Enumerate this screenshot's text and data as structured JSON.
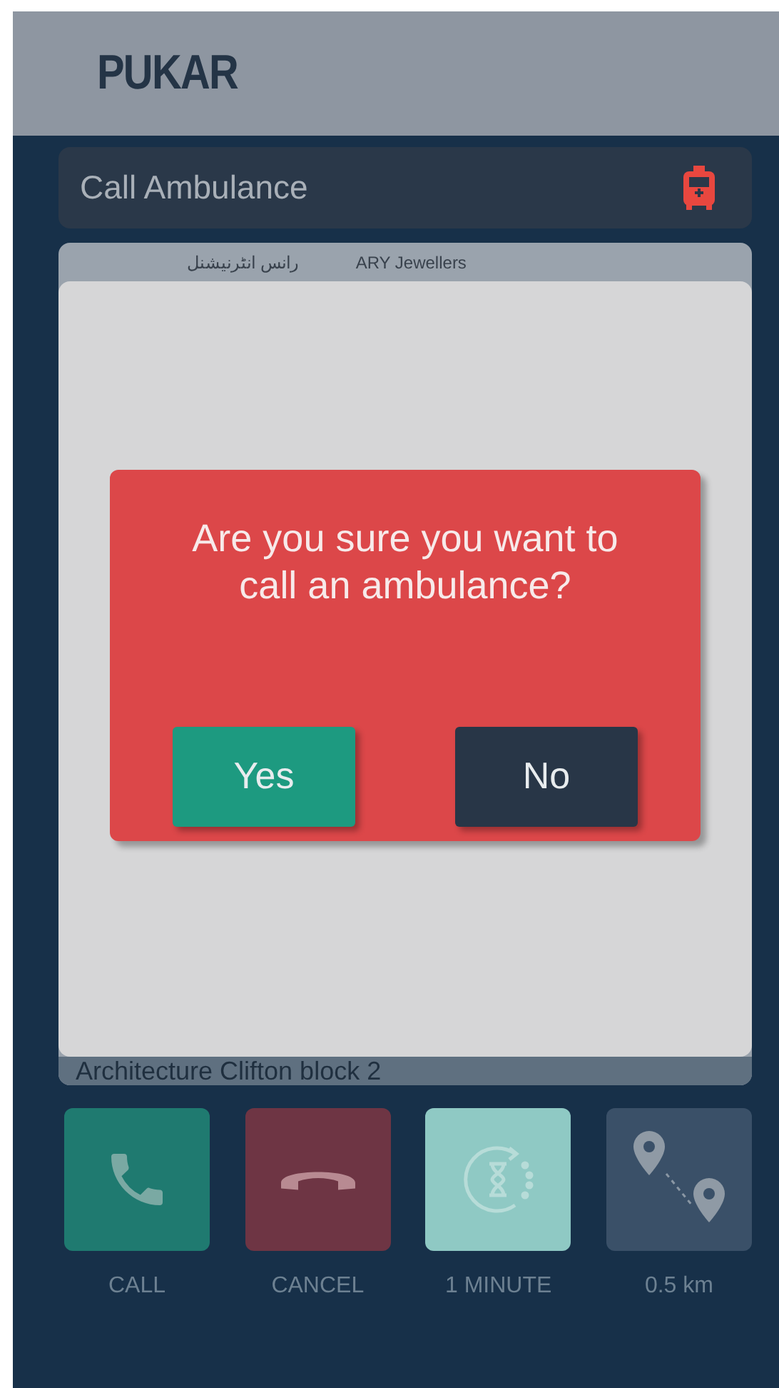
{
  "header": {
    "logo": "PUKAR"
  },
  "title_bar": {
    "title": "Call Ambulance"
  },
  "map": {
    "labels": [
      "رانس انٹرنیشنل",
      "ARY Jewellers"
    ]
  },
  "dialog": {
    "message": "Are you sure you want to call an ambulance?",
    "buttons": [
      {
        "label": "Yes",
        "kind": "confirm"
      },
      {
        "label": "No",
        "kind": "dismiss"
      }
    ]
  },
  "address_bar": {
    "text": "Architecture Clifton block 2"
  },
  "actions": [
    {
      "kind": "call",
      "label": "CALL"
    },
    {
      "kind": "cancel",
      "label": "CANCEL"
    },
    {
      "kind": "timer",
      "label": "1 MINUTE"
    },
    {
      "kind": "distance",
      "label": "0.5 km"
    }
  ]
}
